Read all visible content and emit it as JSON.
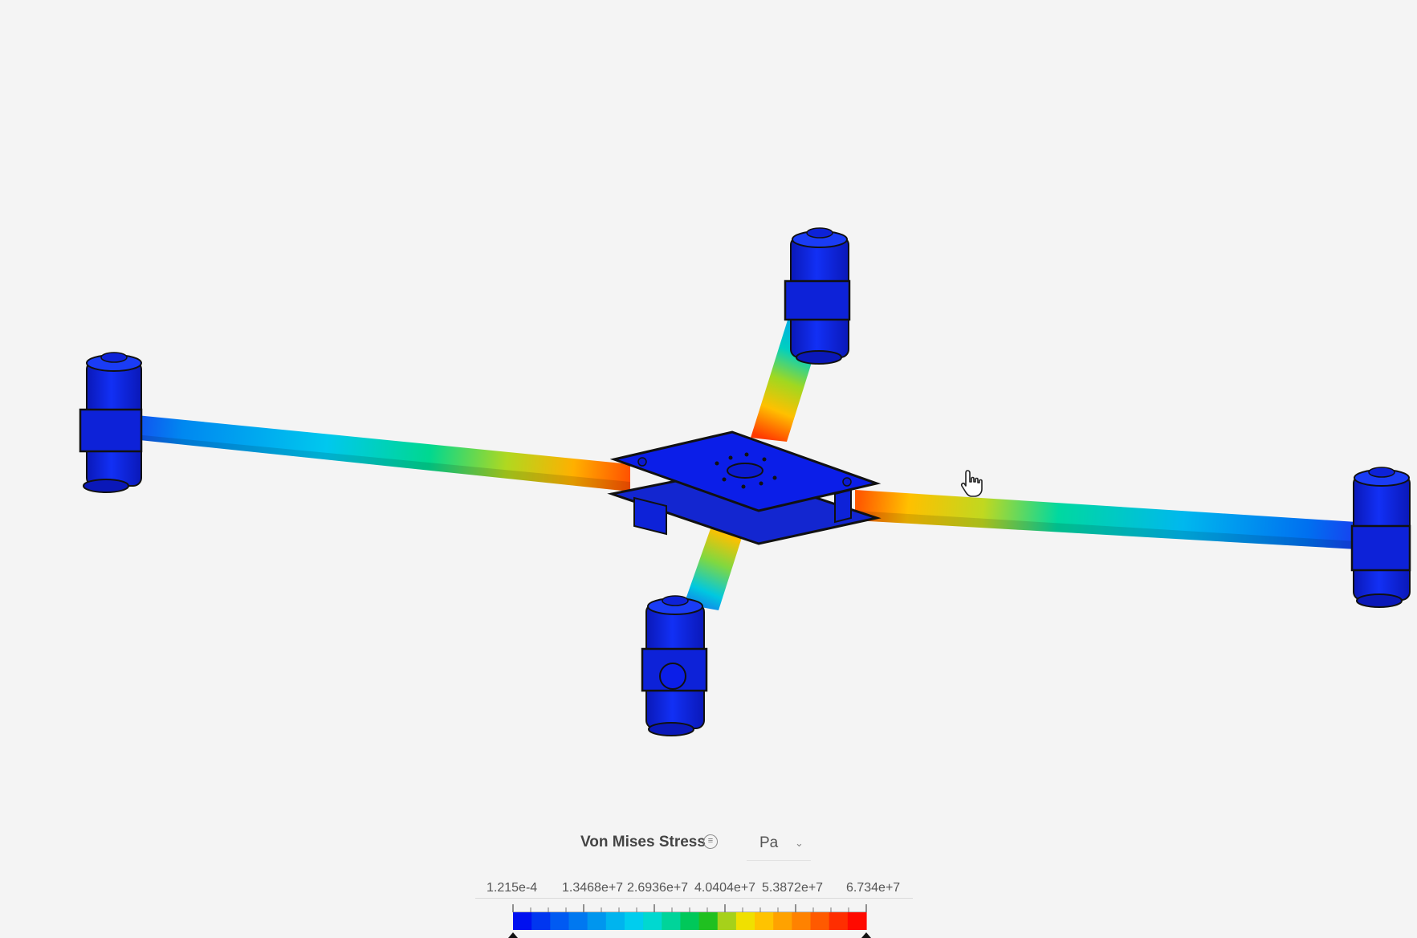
{
  "legend": {
    "title": "Von Mises Stress",
    "info_icon": "menu-lines-icon",
    "unit": "Pa",
    "unit_icon": "chevron-down-icon",
    "ticks": [
      "1.215e-4",
      "1.3468e+7",
      "2.6936e+7",
      "4.0404e+7",
      "5.3872e+7",
      "6.734e+7"
    ],
    "min": 0.0001215,
    "max": 67340000,
    "colors": [
      "#0010f0",
      "#0036f0",
      "#005af2",
      "#0078f0",
      "#0096ee",
      "#00b4ee",
      "#00cdee",
      "#00d8d0",
      "#00d49a",
      "#00c85a",
      "#20c020",
      "#a6d11a",
      "#f0e000",
      "#ffc300",
      "#ffa200",
      "#ff8200",
      "#ff5a00",
      "#ff2e00",
      "#ff0a00"
    ]
  },
  "viewport": {
    "background": "#f4f4f4",
    "model_color": "#0b1ee8",
    "cursor": "hand-pointer-icon"
  }
}
